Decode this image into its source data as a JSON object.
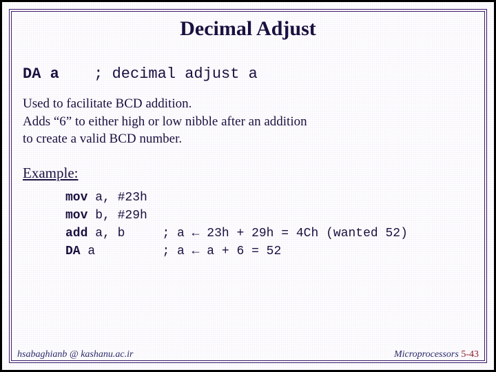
{
  "title": "Decimal Adjust",
  "instruction": {
    "mnemonic": "DA a",
    "comment": "; decimal adjust a"
  },
  "description_lines": [
    "Used to facilitate BCD addition.",
    "Adds “6” to either high or low nibble after an addition",
    "to create a valid BCD number."
  ],
  "example_label": "Example:",
  "code": {
    "l1": {
      "op": "mov",
      "args": "a, #23h",
      "cmt": ""
    },
    "l2": {
      "op": "mov",
      "args": "b, #29h",
      "cmt": ""
    },
    "l3": {
      "op": "add",
      "args": "a, b",
      "cmt": "; a ← 23h + 29h = 4Ch (wanted 52)"
    },
    "l4": {
      "op": "DA",
      "args": "a",
      "cmt": "; a ← a + 6 = 52"
    }
  },
  "footer": {
    "left": "hsabaghianb @ kashanu.ac.ir",
    "right_label": "Microprocessors",
    "pagenum": "5-43"
  }
}
